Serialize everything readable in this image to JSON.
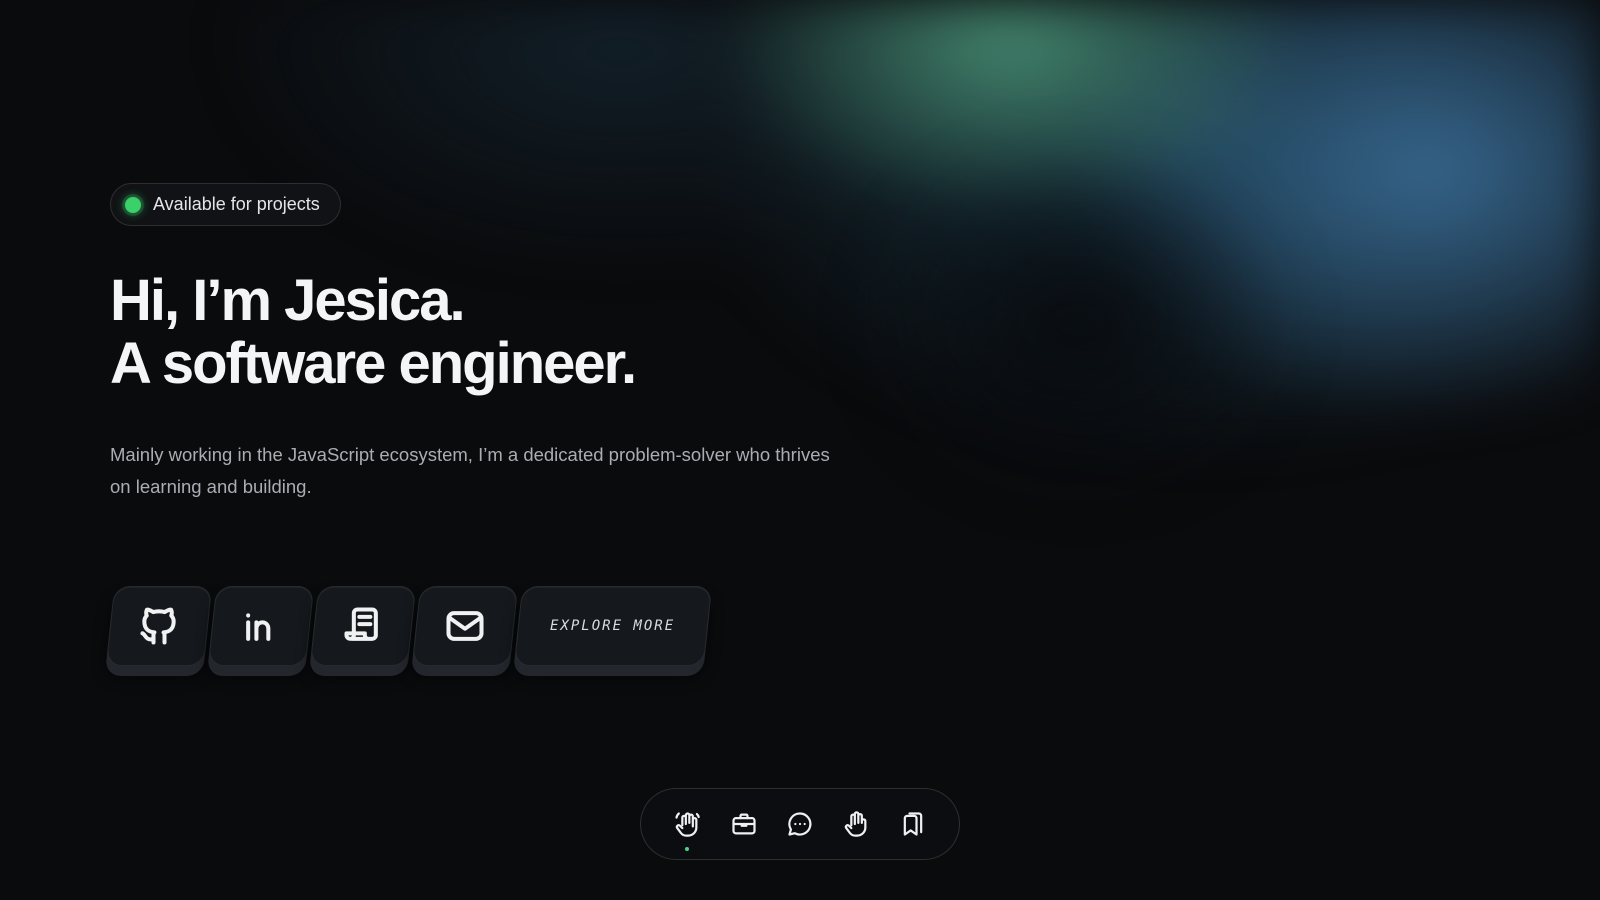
{
  "status_badge": {
    "text": "Available for projects",
    "color": "#3ad16b"
  },
  "hero": {
    "line1": "Hi, I’m Jesica.",
    "line2": "A software engineer.",
    "description": "Mainly working in the JavaScript ecosystem, I’m a dedicated problem-solver who thrives on learning and building."
  },
  "social_keys": [
    {
      "icon": "github-icon"
    },
    {
      "icon": "linkedin-icon"
    },
    {
      "icon": "blog-scroll-icon"
    },
    {
      "icon": "mail-icon"
    }
  ],
  "explore_label": "EXPLORE MORE",
  "dock": {
    "items": [
      {
        "icon": "wave-hand-icon",
        "active": true
      },
      {
        "icon": "briefcase-icon",
        "active": false
      },
      {
        "icon": "chat-bubble-icon",
        "active": false
      },
      {
        "icon": "raised-hand-icon",
        "active": false
      },
      {
        "icon": "bookmarks-icon",
        "active": false
      }
    ],
    "active_color": "#4fd08a"
  }
}
